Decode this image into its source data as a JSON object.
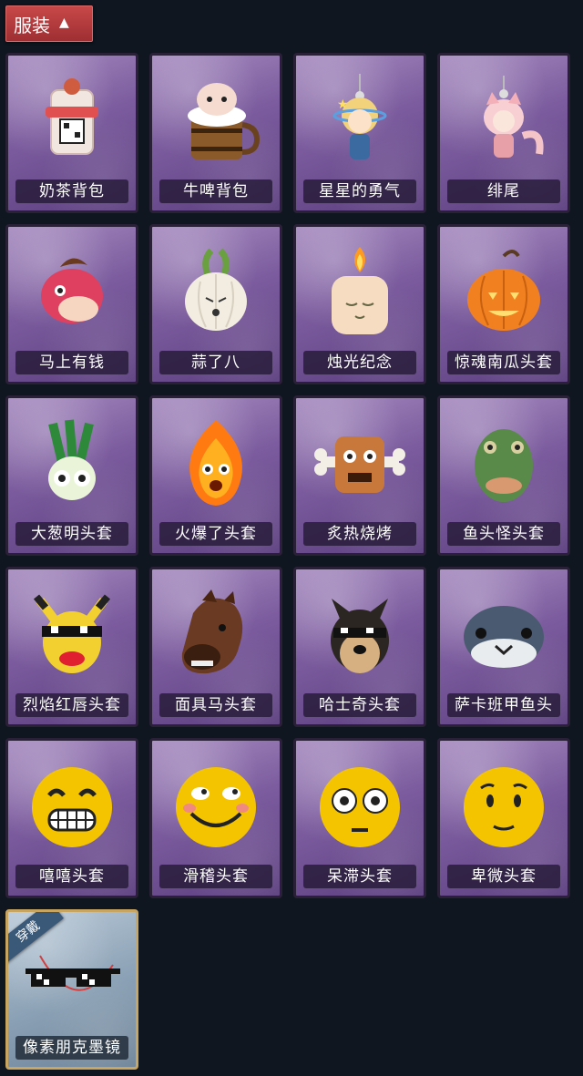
{
  "header": {
    "label": "服装",
    "icon": "chevron-up-icon"
  },
  "equipped_tag": "穿戴",
  "items": [
    {
      "name": "奶茶背包",
      "icon": "milk-tea-backpack-icon",
      "color": "#f1e6e0"
    },
    {
      "name": "牛啤背包",
      "icon": "cow-beer-barrel-icon",
      "color": "#8a5a2a"
    },
    {
      "name": "星星的勇气",
      "icon": "star-doll-charm-icon",
      "color": "#e8c86a"
    },
    {
      "name": "绯尾",
      "icon": "fox-girl-charm-icon",
      "color": "#f4c4c8"
    },
    {
      "name": "马上有钱",
      "icon": "red-horse-head-icon",
      "color": "#e04060"
    },
    {
      "name": "蒜了八",
      "icon": "garlic-head-icon",
      "color": "#f2ede0"
    },
    {
      "name": "烛光纪念",
      "icon": "candle-head-icon",
      "color": "#f6dcc0"
    },
    {
      "name": "惊魂南瓜头套",
      "icon": "pumpkin-head-icon",
      "color": "#f08020"
    },
    {
      "name": "大葱明头套",
      "icon": "scallion-head-icon",
      "color": "#7ac45a"
    },
    {
      "name": "火爆了头套",
      "icon": "fire-head-icon",
      "color": "#ff7a10"
    },
    {
      "name": "炙热烧烤",
      "icon": "meat-bone-head-icon",
      "color": "#c8783a"
    },
    {
      "name": "鱼头怪头套",
      "icon": "fish-mask-icon",
      "color": "#5a8a4a"
    },
    {
      "name": "烈焰红唇头套",
      "icon": "yellow-mouse-mask-icon",
      "color": "#f2d030"
    },
    {
      "name": "面具马头套",
      "icon": "horse-mask-icon",
      "color": "#6a3a22"
    },
    {
      "name": "哈士奇头套",
      "icon": "husky-mask-icon",
      "color": "#2c2622"
    },
    {
      "name": "萨卡班甲鱼头",
      "icon": "sacabambaspis-head-icon",
      "color": "#4a5a70"
    },
    {
      "name": "嘻嘻头套",
      "icon": "grinning-emoji-head-icon",
      "color": "#f5c400"
    },
    {
      "name": "滑稽头套",
      "icon": "smirk-emoji-head-icon",
      "color": "#f5c400"
    },
    {
      "name": "呆滞头套",
      "icon": "flushed-emoji-head-icon",
      "color": "#f5c400"
    },
    {
      "name": "卑微头套",
      "icon": "humble-emoji-head-icon",
      "color": "#f5c400"
    },
    {
      "name": "像素朋克墨镜",
      "icon": "pixel-sunglasses-icon",
      "color": "#111111",
      "equipped": true
    }
  ]
}
